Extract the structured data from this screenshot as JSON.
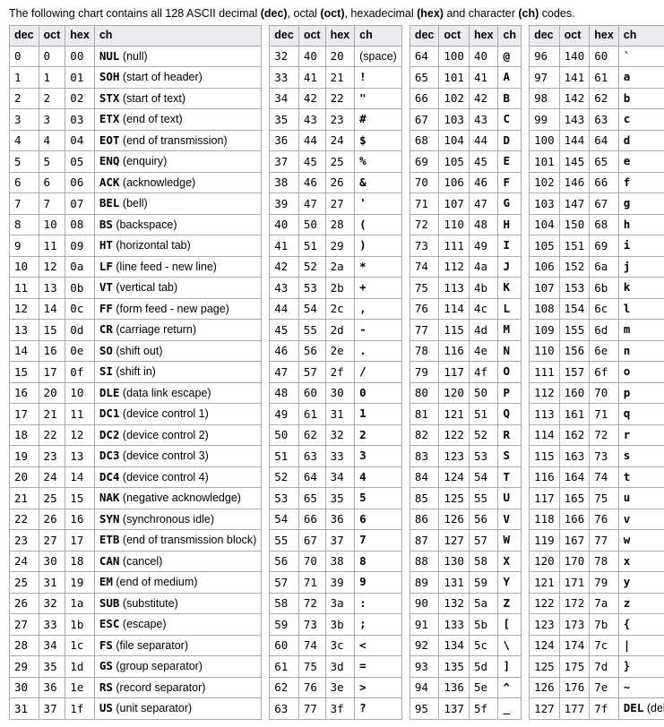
{
  "intro_parts": [
    {
      "t": "The following chart contains all 128 ASCII decimal ",
      "b": false
    },
    {
      "t": "(dec)",
      "b": true
    },
    {
      "t": ", octal ",
      "b": false
    },
    {
      "t": "(oct)",
      "b": true
    },
    {
      "t": ", hexadecimal ",
      "b": false
    },
    {
      "t": "(hex)",
      "b": true
    },
    {
      "t": " and character ",
      "b": false
    },
    {
      "t": "(ch)",
      "b": true
    },
    {
      "t": " codes.",
      "b": false
    }
  ],
  "headers": [
    "dec",
    "oct",
    "hex",
    "ch"
  ],
  "chart_data": {
    "type": "table",
    "columns": [
      [
        {
          "dec": "0",
          "oct": "0",
          "hex": "00",
          "ch": "NUL",
          "desc": "(null)"
        },
        {
          "dec": "1",
          "oct": "1",
          "hex": "01",
          "ch": "SOH",
          "desc": "(start of header)"
        },
        {
          "dec": "2",
          "oct": "2",
          "hex": "02",
          "ch": "STX",
          "desc": "(start of text)"
        },
        {
          "dec": "3",
          "oct": "3",
          "hex": "03",
          "ch": "ETX",
          "desc": "(end of text)"
        },
        {
          "dec": "4",
          "oct": "4",
          "hex": "04",
          "ch": "EOT",
          "desc": "(end of transmission)"
        },
        {
          "dec": "5",
          "oct": "5",
          "hex": "05",
          "ch": "ENQ",
          "desc": "(enquiry)"
        },
        {
          "dec": "6",
          "oct": "6",
          "hex": "06",
          "ch": "ACK",
          "desc": "(acknowledge)"
        },
        {
          "dec": "7",
          "oct": "7",
          "hex": "07",
          "ch": "BEL",
          "desc": "(bell)"
        },
        {
          "dec": "8",
          "oct": "10",
          "hex": "08",
          "ch": "BS",
          "desc": "(backspace)"
        },
        {
          "dec": "9",
          "oct": "11",
          "hex": "09",
          "ch": "HT",
          "desc": "(horizontal tab)"
        },
        {
          "dec": "10",
          "oct": "12",
          "hex": "0a",
          "ch": "LF",
          "desc": "(line feed - new line)"
        },
        {
          "dec": "11",
          "oct": "13",
          "hex": "0b",
          "ch": "VT",
          "desc": "(vertical tab)"
        },
        {
          "dec": "12",
          "oct": "14",
          "hex": "0c",
          "ch": "FF",
          "desc": "(form feed - new page)"
        },
        {
          "dec": "13",
          "oct": "15",
          "hex": "0d",
          "ch": "CR",
          "desc": "(carriage return)"
        },
        {
          "dec": "14",
          "oct": "16",
          "hex": "0e",
          "ch": "SO",
          "desc": "(shift out)"
        },
        {
          "dec": "15",
          "oct": "17",
          "hex": "0f",
          "ch": "SI",
          "desc": "(shift in)"
        },
        {
          "dec": "16",
          "oct": "20",
          "hex": "10",
          "ch": "DLE",
          "desc": "(data link escape)"
        },
        {
          "dec": "17",
          "oct": "21",
          "hex": "11",
          "ch": "DC1",
          "desc": "(device control 1)"
        },
        {
          "dec": "18",
          "oct": "22",
          "hex": "12",
          "ch": "DC2",
          "desc": "(device control 2)"
        },
        {
          "dec": "19",
          "oct": "23",
          "hex": "13",
          "ch": "DC3",
          "desc": "(device control 3)"
        },
        {
          "dec": "20",
          "oct": "24",
          "hex": "14",
          "ch": "DC4",
          "desc": "(device control 4)"
        },
        {
          "dec": "21",
          "oct": "25",
          "hex": "15",
          "ch": "NAK",
          "desc": "(negative acknowledge)"
        },
        {
          "dec": "22",
          "oct": "26",
          "hex": "16",
          "ch": "SYN",
          "desc": "(synchronous idle)"
        },
        {
          "dec": "23",
          "oct": "27",
          "hex": "17",
          "ch": "ETB",
          "desc": "(end of transmission block)"
        },
        {
          "dec": "24",
          "oct": "30",
          "hex": "18",
          "ch": "CAN",
          "desc": "(cancel)"
        },
        {
          "dec": "25",
          "oct": "31",
          "hex": "19",
          "ch": "EM",
          "desc": "(end of medium)"
        },
        {
          "dec": "26",
          "oct": "32",
          "hex": "1a",
          "ch": "SUB",
          "desc": "(substitute)"
        },
        {
          "dec": "27",
          "oct": "33",
          "hex": "1b",
          "ch": "ESC",
          "desc": "(escape)"
        },
        {
          "dec": "28",
          "oct": "34",
          "hex": "1c",
          "ch": "FS",
          "desc": "(file separator)"
        },
        {
          "dec": "29",
          "oct": "35",
          "hex": "1d",
          "ch": "GS",
          "desc": "(group separator)"
        },
        {
          "dec": "30",
          "oct": "36",
          "hex": "1e",
          "ch": "RS",
          "desc": "(record separator)"
        },
        {
          "dec": "31",
          "oct": "37",
          "hex": "1f",
          "ch": "US",
          "desc": "(unit separator)"
        }
      ],
      [
        {
          "dec": "32",
          "oct": "40",
          "hex": "20",
          "ch": "",
          "desc": "(space)"
        },
        {
          "dec": "33",
          "oct": "41",
          "hex": "21",
          "ch": "!"
        },
        {
          "dec": "34",
          "oct": "42",
          "hex": "22",
          "ch": "\""
        },
        {
          "dec": "35",
          "oct": "43",
          "hex": "23",
          "ch": "#"
        },
        {
          "dec": "36",
          "oct": "44",
          "hex": "24",
          "ch": "$"
        },
        {
          "dec": "37",
          "oct": "45",
          "hex": "25",
          "ch": "%"
        },
        {
          "dec": "38",
          "oct": "46",
          "hex": "26",
          "ch": "&"
        },
        {
          "dec": "39",
          "oct": "47",
          "hex": "27",
          "ch": "'"
        },
        {
          "dec": "40",
          "oct": "50",
          "hex": "28",
          "ch": "("
        },
        {
          "dec": "41",
          "oct": "51",
          "hex": "29",
          "ch": ")"
        },
        {
          "dec": "42",
          "oct": "52",
          "hex": "2a",
          "ch": "*"
        },
        {
          "dec": "43",
          "oct": "53",
          "hex": "2b",
          "ch": "+"
        },
        {
          "dec": "44",
          "oct": "54",
          "hex": "2c",
          "ch": ","
        },
        {
          "dec": "45",
          "oct": "55",
          "hex": "2d",
          "ch": "-"
        },
        {
          "dec": "46",
          "oct": "56",
          "hex": "2e",
          "ch": "."
        },
        {
          "dec": "47",
          "oct": "57",
          "hex": "2f",
          "ch": "/"
        },
        {
          "dec": "48",
          "oct": "60",
          "hex": "30",
          "ch": "0"
        },
        {
          "dec": "49",
          "oct": "61",
          "hex": "31",
          "ch": "1"
        },
        {
          "dec": "50",
          "oct": "62",
          "hex": "32",
          "ch": "2"
        },
        {
          "dec": "51",
          "oct": "63",
          "hex": "33",
          "ch": "3"
        },
        {
          "dec": "52",
          "oct": "64",
          "hex": "34",
          "ch": "4"
        },
        {
          "dec": "53",
          "oct": "65",
          "hex": "35",
          "ch": "5"
        },
        {
          "dec": "54",
          "oct": "66",
          "hex": "36",
          "ch": "6"
        },
        {
          "dec": "55",
          "oct": "67",
          "hex": "37",
          "ch": "7"
        },
        {
          "dec": "56",
          "oct": "70",
          "hex": "38",
          "ch": "8"
        },
        {
          "dec": "57",
          "oct": "71",
          "hex": "39",
          "ch": "9"
        },
        {
          "dec": "58",
          "oct": "72",
          "hex": "3a",
          "ch": ":"
        },
        {
          "dec": "59",
          "oct": "73",
          "hex": "3b",
          "ch": ";"
        },
        {
          "dec": "60",
          "oct": "74",
          "hex": "3c",
          "ch": "<"
        },
        {
          "dec": "61",
          "oct": "75",
          "hex": "3d",
          "ch": "="
        },
        {
          "dec": "62",
          "oct": "76",
          "hex": "3e",
          "ch": ">"
        },
        {
          "dec": "63",
          "oct": "77",
          "hex": "3f",
          "ch": "?"
        }
      ],
      [
        {
          "dec": "64",
          "oct": "100",
          "hex": "40",
          "ch": "@"
        },
        {
          "dec": "65",
          "oct": "101",
          "hex": "41",
          "ch": "A"
        },
        {
          "dec": "66",
          "oct": "102",
          "hex": "42",
          "ch": "B"
        },
        {
          "dec": "67",
          "oct": "103",
          "hex": "43",
          "ch": "C"
        },
        {
          "dec": "68",
          "oct": "104",
          "hex": "44",
          "ch": "D"
        },
        {
          "dec": "69",
          "oct": "105",
          "hex": "45",
          "ch": "E"
        },
        {
          "dec": "70",
          "oct": "106",
          "hex": "46",
          "ch": "F"
        },
        {
          "dec": "71",
          "oct": "107",
          "hex": "47",
          "ch": "G"
        },
        {
          "dec": "72",
          "oct": "110",
          "hex": "48",
          "ch": "H"
        },
        {
          "dec": "73",
          "oct": "111",
          "hex": "49",
          "ch": "I"
        },
        {
          "dec": "74",
          "oct": "112",
          "hex": "4a",
          "ch": "J"
        },
        {
          "dec": "75",
          "oct": "113",
          "hex": "4b",
          "ch": "K"
        },
        {
          "dec": "76",
          "oct": "114",
          "hex": "4c",
          "ch": "L"
        },
        {
          "dec": "77",
          "oct": "115",
          "hex": "4d",
          "ch": "M"
        },
        {
          "dec": "78",
          "oct": "116",
          "hex": "4e",
          "ch": "N"
        },
        {
          "dec": "79",
          "oct": "117",
          "hex": "4f",
          "ch": "O"
        },
        {
          "dec": "80",
          "oct": "120",
          "hex": "50",
          "ch": "P"
        },
        {
          "dec": "81",
          "oct": "121",
          "hex": "51",
          "ch": "Q"
        },
        {
          "dec": "82",
          "oct": "122",
          "hex": "52",
          "ch": "R"
        },
        {
          "dec": "83",
          "oct": "123",
          "hex": "53",
          "ch": "S"
        },
        {
          "dec": "84",
          "oct": "124",
          "hex": "54",
          "ch": "T"
        },
        {
          "dec": "85",
          "oct": "125",
          "hex": "55",
          "ch": "U"
        },
        {
          "dec": "86",
          "oct": "126",
          "hex": "56",
          "ch": "V"
        },
        {
          "dec": "87",
          "oct": "127",
          "hex": "57",
          "ch": "W"
        },
        {
          "dec": "88",
          "oct": "130",
          "hex": "58",
          "ch": "X"
        },
        {
          "dec": "89",
          "oct": "131",
          "hex": "59",
          "ch": "Y"
        },
        {
          "dec": "90",
          "oct": "132",
          "hex": "5a",
          "ch": "Z"
        },
        {
          "dec": "91",
          "oct": "133",
          "hex": "5b",
          "ch": "["
        },
        {
          "dec": "92",
          "oct": "134",
          "hex": "5c",
          "ch": "\\"
        },
        {
          "dec": "93",
          "oct": "135",
          "hex": "5d",
          "ch": "]"
        },
        {
          "dec": "94",
          "oct": "136",
          "hex": "5e",
          "ch": "^"
        },
        {
          "dec": "95",
          "oct": "137",
          "hex": "5f",
          "ch": "_"
        }
      ],
      [
        {
          "dec": "96",
          "oct": "140",
          "hex": "60",
          "ch": "`"
        },
        {
          "dec": "97",
          "oct": "141",
          "hex": "61",
          "ch": "a"
        },
        {
          "dec": "98",
          "oct": "142",
          "hex": "62",
          "ch": "b"
        },
        {
          "dec": "99",
          "oct": "143",
          "hex": "63",
          "ch": "c"
        },
        {
          "dec": "100",
          "oct": "144",
          "hex": "64",
          "ch": "d"
        },
        {
          "dec": "101",
          "oct": "145",
          "hex": "65",
          "ch": "e"
        },
        {
          "dec": "102",
          "oct": "146",
          "hex": "66",
          "ch": "f"
        },
        {
          "dec": "103",
          "oct": "147",
          "hex": "67",
          "ch": "g"
        },
        {
          "dec": "104",
          "oct": "150",
          "hex": "68",
          "ch": "h"
        },
        {
          "dec": "105",
          "oct": "151",
          "hex": "69",
          "ch": "i"
        },
        {
          "dec": "106",
          "oct": "152",
          "hex": "6a",
          "ch": "j"
        },
        {
          "dec": "107",
          "oct": "153",
          "hex": "6b",
          "ch": "k"
        },
        {
          "dec": "108",
          "oct": "154",
          "hex": "6c",
          "ch": "l"
        },
        {
          "dec": "109",
          "oct": "155",
          "hex": "6d",
          "ch": "m"
        },
        {
          "dec": "110",
          "oct": "156",
          "hex": "6e",
          "ch": "n"
        },
        {
          "dec": "111",
          "oct": "157",
          "hex": "6f",
          "ch": "o"
        },
        {
          "dec": "112",
          "oct": "160",
          "hex": "70",
          "ch": "p"
        },
        {
          "dec": "113",
          "oct": "161",
          "hex": "71",
          "ch": "q"
        },
        {
          "dec": "114",
          "oct": "162",
          "hex": "72",
          "ch": "r"
        },
        {
          "dec": "115",
          "oct": "163",
          "hex": "73",
          "ch": "s"
        },
        {
          "dec": "116",
          "oct": "164",
          "hex": "74",
          "ch": "t"
        },
        {
          "dec": "117",
          "oct": "165",
          "hex": "75",
          "ch": "u"
        },
        {
          "dec": "118",
          "oct": "166",
          "hex": "76",
          "ch": "v"
        },
        {
          "dec": "119",
          "oct": "167",
          "hex": "77",
          "ch": "w"
        },
        {
          "dec": "120",
          "oct": "170",
          "hex": "78",
          "ch": "x"
        },
        {
          "dec": "121",
          "oct": "171",
          "hex": "79",
          "ch": "y"
        },
        {
          "dec": "122",
          "oct": "172",
          "hex": "7a",
          "ch": "z"
        },
        {
          "dec": "123",
          "oct": "173",
          "hex": "7b",
          "ch": "{"
        },
        {
          "dec": "124",
          "oct": "174",
          "hex": "7c",
          "ch": "|"
        },
        {
          "dec": "125",
          "oct": "175",
          "hex": "7d",
          "ch": "}"
        },
        {
          "dec": "126",
          "oct": "176",
          "hex": "7e",
          "ch": "~"
        },
        {
          "dec": "127",
          "oct": "177",
          "hex": "7f",
          "ch": "DEL",
          "desc": "(delete)"
        }
      ]
    ]
  }
}
